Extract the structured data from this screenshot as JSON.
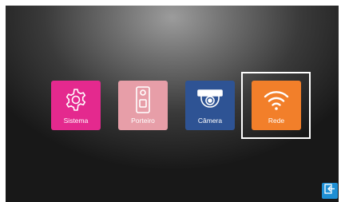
{
  "menu": {
    "items": [
      {
        "label": "Sistema",
        "icon": "gear-icon",
        "color": "#e4298e"
      },
      {
        "label": "Porteiro",
        "icon": "doorbell-icon",
        "color": "#e79ea8"
      },
      {
        "label": "Câmera",
        "icon": "dome-camera-icon",
        "color": "#2e5394"
      },
      {
        "label": "Rede",
        "icon": "wifi-icon",
        "color": "#f27f2a",
        "selected": true
      }
    ]
  },
  "exit_button": {
    "icon": "exit-icon",
    "color": "#1e8fd4"
  }
}
